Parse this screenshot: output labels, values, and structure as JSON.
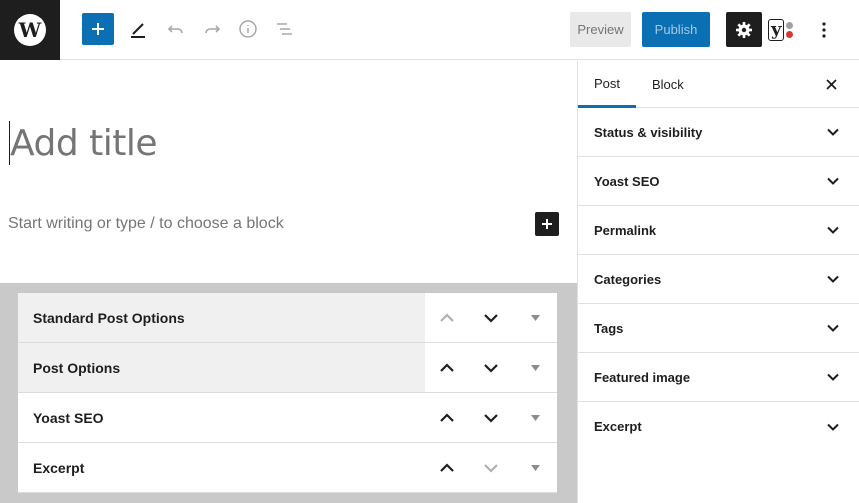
{
  "topbar": {
    "add_block_icon": "plus-icon",
    "tools_icon": "pencil-icon",
    "undo_icon": "undo-icon",
    "redo_icon": "redo-icon",
    "info_icon": "info-icon",
    "outline_icon": "list-view-icon",
    "preview_label": "Preview",
    "publish_label": "Publish",
    "settings_icon": "gear-icon",
    "yoast_label": "y",
    "more_icon": "kebab-menu-icon"
  },
  "editor": {
    "title_placeholder": "Add title",
    "body_placeholder": "Start writing or type / to choose a block"
  },
  "metaboxes": [
    {
      "label": "Standard Post Options",
      "up_enabled": false,
      "down_enabled": true
    },
    {
      "label": "Post Options",
      "up_enabled": true,
      "down_enabled": true
    },
    {
      "label": "Yoast SEO",
      "up_enabled": true,
      "down_enabled": true
    },
    {
      "label": "Excerpt",
      "up_enabled": true,
      "down_enabled": false
    }
  ],
  "sidebar": {
    "tabs": [
      {
        "label": "Post",
        "active": true
      },
      {
        "label": "Block",
        "active": false
      }
    ],
    "panels": [
      "Status & visibility",
      "Yoast SEO",
      "Permalink",
      "Categories",
      "Tags",
      "Featured image",
      "Excerpt"
    ]
  },
  "colors": {
    "accent": "#0b6fb3",
    "dark": "#1e1e1e",
    "yoast_dot_top": "#a0a0a0",
    "yoast_dot_bottom": "#d23b2f"
  }
}
